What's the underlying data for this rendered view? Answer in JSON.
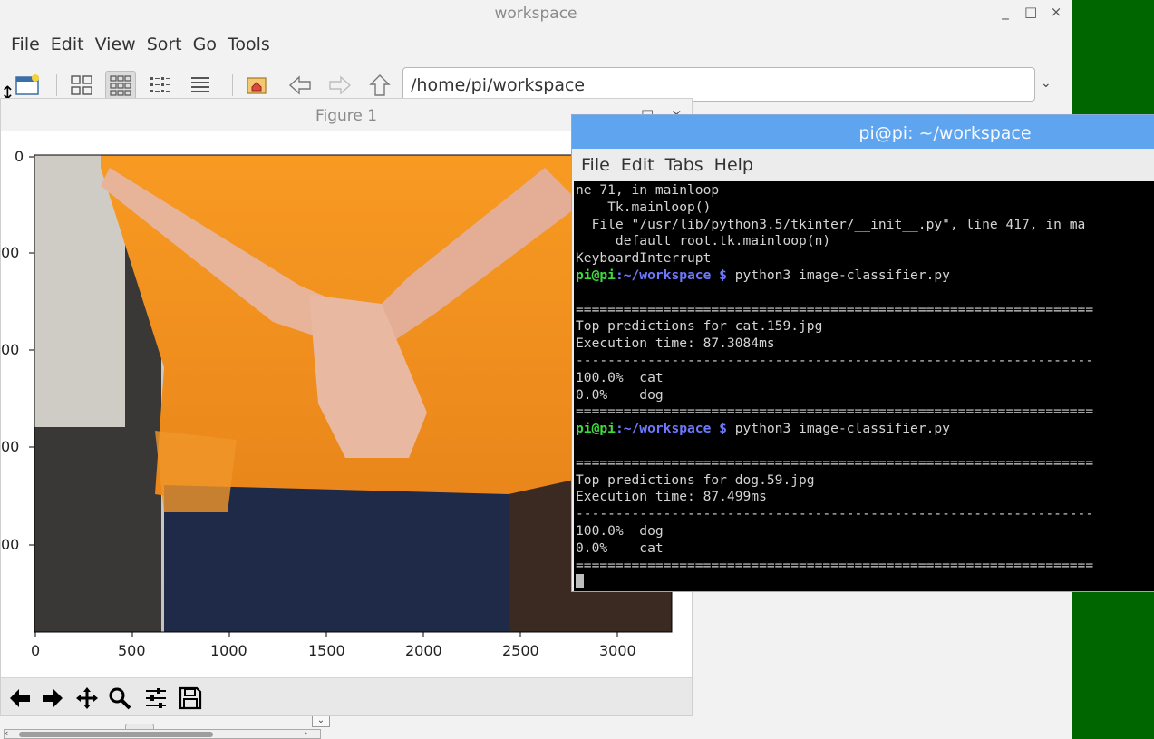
{
  "desktop": {
    "background_color": "#006600"
  },
  "file_manager": {
    "title": "workspace",
    "window_controls": [
      "_",
      "□",
      "×"
    ],
    "menu": [
      "File",
      "Edit",
      "View",
      "Sort",
      "Go",
      "Tools"
    ],
    "toolbar_icons": [
      "new-window-icon",
      "icon-view-icon",
      "thumbnail-view-icon",
      "compact-view-icon",
      "list-view-icon",
      "home-icon",
      "back-arrow-icon",
      "forward-arrow-icon",
      "up-arrow-icon"
    ],
    "active_view": "thumbnail-view-icon",
    "address": "/home/pi/workspace",
    "address_dropdown": "⌄"
  },
  "figure": {
    "title": "Figure 1",
    "window_controls": [
      "□",
      "×"
    ],
    "image": {
      "description_colors": {
        "shirt": "#f7901e",
        "wall": "#e3e0dc",
        "shadow": "#3a3a3a",
        "jeans": "#1e2a4a",
        "skin": "#e8b7a0"
      }
    },
    "x_ticks": [
      "0",
      "500",
      "1000",
      "1500",
      "2000",
      "2500",
      "3000"
    ],
    "y_ticks": [
      "0",
      "00",
      "00",
      "00",
      "00"
    ],
    "toolbar_icons": [
      "home-arrow-back-icon",
      "forward-arrow-icon",
      "pan-icon",
      "zoom-icon",
      "configure-subplots-icon",
      "save-icon"
    ]
  },
  "terminal": {
    "title": "pi@pi: ~/workspace",
    "menu": [
      "File",
      "Edit",
      "Tabs",
      "Help"
    ],
    "lines": [
      {
        "type": "text",
        "text": "ne 71, in mainloop"
      },
      {
        "type": "text",
        "text": "    Tk.mainloop()"
      },
      {
        "type": "text",
        "text": "  File \"/usr/lib/python3.5/tkinter/__init__.py\", line 417, in ma"
      },
      {
        "type": "text",
        "text": "    _default_root.tk.mainloop(n)"
      },
      {
        "type": "text",
        "text": "KeyboardInterrupt"
      },
      {
        "type": "prompt",
        "user": "pi@pi",
        "path": ":~/workspace $",
        "cmd": " python3 image-classifier.py"
      },
      {
        "type": "text",
        "text": ""
      },
      {
        "type": "text",
        "text": "================================================================="
      },
      {
        "type": "text",
        "text": "Top predictions for cat.159.jpg"
      },
      {
        "type": "text",
        "text": "Execution time: 87.3084ms"
      },
      {
        "type": "text",
        "text": "-----------------------------------------------------------------"
      },
      {
        "type": "text",
        "text": "100.0%  cat"
      },
      {
        "type": "text",
        "text": "0.0%    dog"
      },
      {
        "type": "text",
        "text": "================================================================="
      },
      {
        "type": "prompt",
        "user": "pi@pi",
        "path": ":~/workspace $",
        "cmd": " python3 image-classifier.py"
      },
      {
        "type": "text",
        "text": ""
      },
      {
        "type": "text",
        "text": "================================================================="
      },
      {
        "type": "text",
        "text": "Top predictions for dog.59.jpg"
      },
      {
        "type": "text",
        "text": "Execution time: 87.499ms"
      },
      {
        "type": "text",
        "text": "-----------------------------------------------------------------"
      },
      {
        "type": "text",
        "text": "100.0%  dog"
      },
      {
        "type": "text",
        "text": "0.0%    cat"
      },
      {
        "type": "text",
        "text": "================================================================="
      },
      {
        "type": "cursor",
        "text": ""
      }
    ]
  }
}
